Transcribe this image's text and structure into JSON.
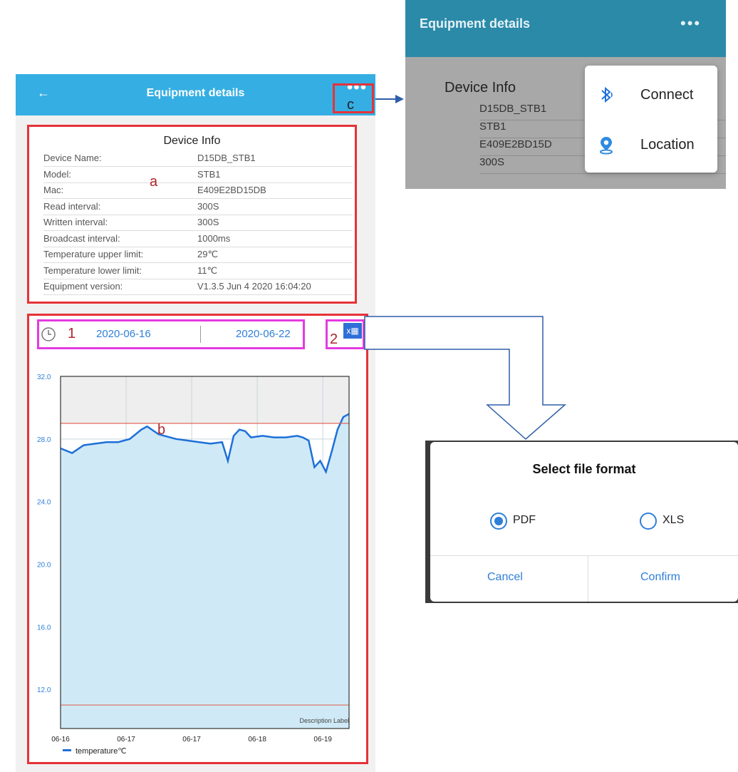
{
  "app": {
    "title": "Equipment details",
    "back_icon": "arrow-left-icon",
    "more_label": "•••"
  },
  "device_info": {
    "heading": "Device Info",
    "rows": [
      {
        "label": "Device Name:",
        "value": "D15DB_STB1"
      },
      {
        "label": "Model:",
        "value": "STB1"
      },
      {
        "label": "Mac:",
        "value": "E409E2BD15DB"
      },
      {
        "label": "Read interval:",
        "value": "300S"
      },
      {
        "label": "Written interval:",
        "value": "300S"
      },
      {
        "label": "Broadcast interval:",
        "value": "1000ms"
      },
      {
        "label": "Temperature upper limit:",
        "value": "29℃"
      },
      {
        "label": "Temperature lower limit:",
        "value": "11℃"
      },
      {
        "label": "Equipment version:",
        "value": "V1.3.5 Jun  4 2020 16:04:20"
      }
    ]
  },
  "date_range": {
    "start": "2020-06-16",
    "end": "2020-06-22",
    "clock_icon": "clock-icon",
    "export_icon": "excel-export-icon",
    "export_label": "x"
  },
  "annotations": {
    "a": "a",
    "b": "b",
    "c": "c",
    "one": "1",
    "two": "2"
  },
  "chart_data": {
    "type": "area",
    "title": "",
    "description_label": "Description Label",
    "xlabel": "",
    "ylabel": "",
    "ylim": [
      9.5,
      32.0
    ],
    "yticks": [
      "32.0",
      "28.0",
      "24.0",
      "20.0",
      "16.0",
      "12.0"
    ],
    "xticks": [
      "06-16",
      "06-17",
      "06-17",
      "06-18",
      "06-19"
    ],
    "upper_limit": 29,
    "lower_limit": 11,
    "grid": true,
    "legend_position": "bottom-left",
    "series": [
      {
        "name": "temperature℃",
        "color": "#1e6fd9",
        "fill": "#cfeaf6",
        "x": [
          0,
          0.04,
          0.08,
          0.12,
          0.16,
          0.2,
          0.24,
          0.28,
          0.3,
          0.34,
          0.36,
          0.4,
          0.44,
          0.48,
          0.52,
          0.56,
          0.58,
          0.6,
          0.62,
          0.64,
          0.66,
          0.7,
          0.74,
          0.78,
          0.82,
          0.84,
          0.86,
          0.88,
          0.9,
          0.92,
          0.94,
          0.96,
          0.98,
          1.0
        ],
        "values": [
          27.4,
          27.1,
          27.6,
          27.7,
          27.8,
          27.8,
          28.0,
          28.6,
          28.8,
          28.3,
          28.2,
          28.0,
          27.9,
          27.8,
          27.7,
          27.8,
          26.6,
          28.2,
          28.6,
          28.5,
          28.1,
          28.2,
          28.1,
          28.1,
          28.2,
          28.1,
          27.9,
          26.2,
          26.6,
          25.9,
          27.2,
          28.6,
          29.4,
          29.6
        ]
      }
    ]
  },
  "popup_panel": {
    "title": "Equipment details",
    "more_label": "•••",
    "heading": "Device Info",
    "rows": [
      "D15DB_STB1",
      "STB1",
      "E409E2BD15D",
      "300S"
    ],
    "menu": [
      {
        "label": "Connect",
        "icon": "bluetooth-icon"
      },
      {
        "label": "Location",
        "icon": "location-pin-icon"
      }
    ]
  },
  "dialog": {
    "title": "Select file format",
    "options": [
      {
        "label": "PDF",
        "selected": true
      },
      {
        "label": "XLS",
        "selected": false
      }
    ],
    "cancel": "Cancel",
    "confirm": "Confirm"
  },
  "colors": {
    "appbar": "#35aee3",
    "highlight_red": "#e63238",
    "highlight_magenta": "#e43be0",
    "arrow": "#2e5ea8",
    "accent": "#2e7fd8"
  }
}
